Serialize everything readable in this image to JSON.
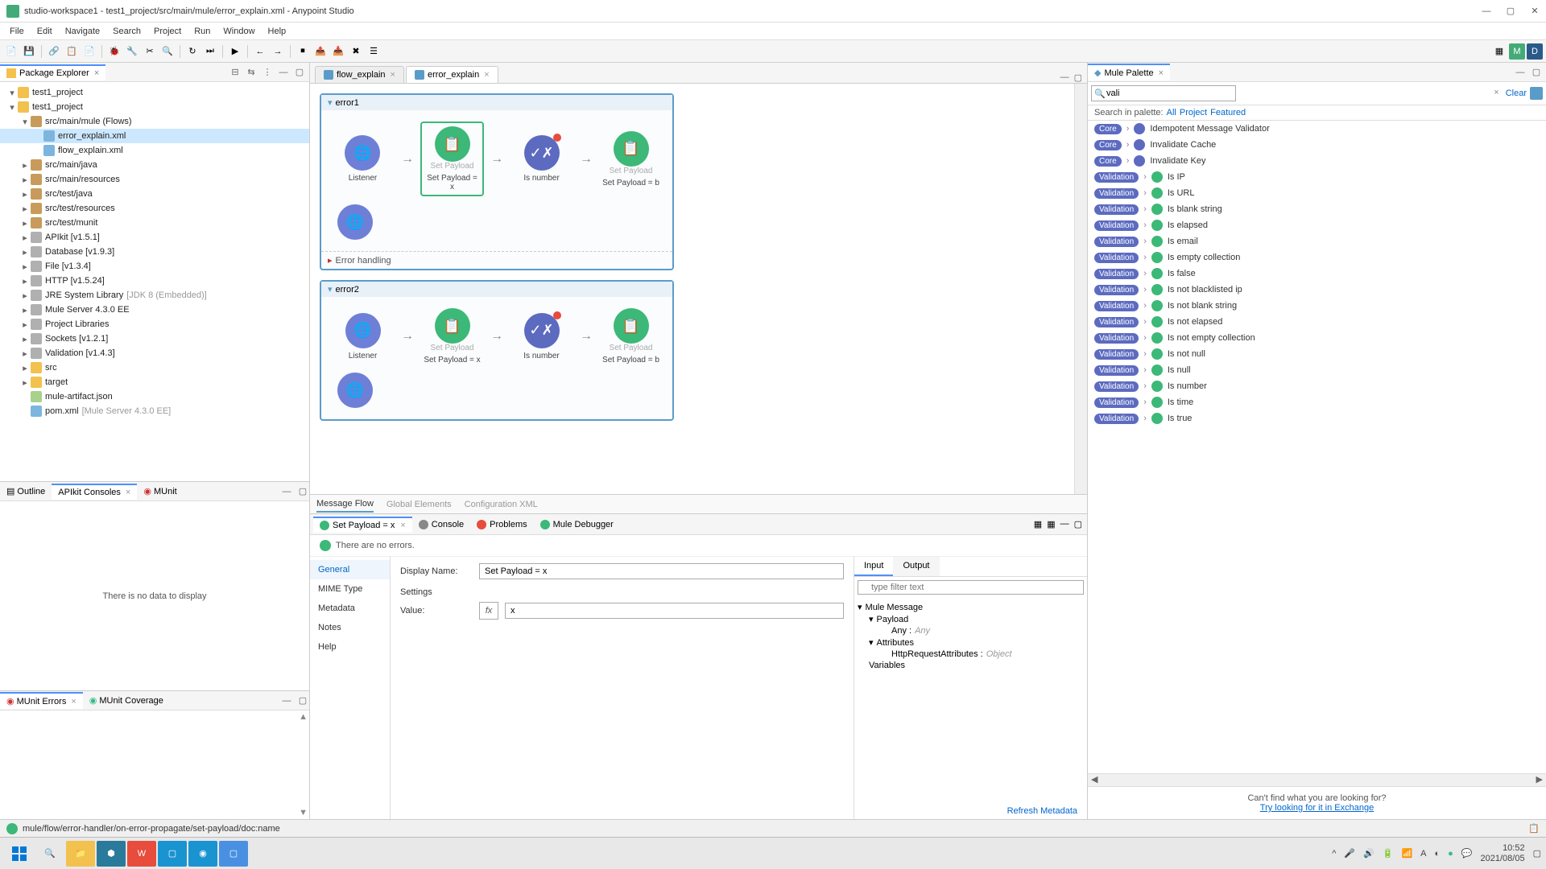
{
  "window": {
    "title": "studio-workspace1 - test1_project/src/main/mule/error_explain.xml - Anypoint Studio"
  },
  "menu": [
    "File",
    "Edit",
    "Navigate",
    "Search",
    "Project",
    "Run",
    "Window",
    "Help"
  ],
  "package_explorer": {
    "tab": "Package Explorer",
    "tree": [
      {
        "d": 0,
        "icon": "folder",
        "label": "test1_project",
        "exp": true
      },
      {
        "d": 0,
        "icon": "folder",
        "label": "test1_project",
        "exp": true
      },
      {
        "d": 1,
        "icon": "pkg",
        "label": "src/main/mule (Flows)",
        "exp": true
      },
      {
        "d": 2,
        "icon": "xml",
        "label": "error_explain.xml",
        "sel": true
      },
      {
        "d": 2,
        "icon": "xml",
        "label": "flow_explain.xml"
      },
      {
        "d": 1,
        "icon": "pkg",
        "label": "src/main/java",
        "exp": false
      },
      {
        "d": 1,
        "icon": "pkg",
        "label": "src/main/resources",
        "exp": false
      },
      {
        "d": 1,
        "icon": "pkg",
        "label": "src/test/java",
        "exp": false
      },
      {
        "d": 1,
        "icon": "pkg",
        "label": "src/test/resources",
        "exp": false
      },
      {
        "d": 1,
        "icon": "pkg",
        "label": "src/test/munit",
        "exp": false
      },
      {
        "d": 1,
        "icon": "jar",
        "label": "APIkit [v1.5.1]",
        "exp": false
      },
      {
        "d": 1,
        "icon": "jar",
        "label": "Database [v1.9.3]",
        "exp": false
      },
      {
        "d": 1,
        "icon": "jar",
        "label": "File [v1.3.4]",
        "exp": false
      },
      {
        "d": 1,
        "icon": "jar",
        "label": "HTTP [v1.5.24]",
        "exp": false
      },
      {
        "d": 1,
        "icon": "jar",
        "label": "JRE System Library",
        "hint": "[JDK 8 (Embedded)]",
        "exp": false
      },
      {
        "d": 1,
        "icon": "jar",
        "label": "Mule Server 4.3.0 EE",
        "exp": false
      },
      {
        "d": 1,
        "icon": "jar",
        "label": "Project Libraries",
        "exp": false
      },
      {
        "d": 1,
        "icon": "jar",
        "label": "Sockets [v1.2.1]",
        "exp": false
      },
      {
        "d": 1,
        "icon": "jar",
        "label": "Validation [v1.4.3]",
        "exp": false
      },
      {
        "d": 1,
        "icon": "folder",
        "label": "src",
        "exp": false
      },
      {
        "d": 1,
        "icon": "folder",
        "label": "target",
        "exp": false
      },
      {
        "d": 1,
        "icon": "json",
        "label": "mule-artifact.json"
      },
      {
        "d": 1,
        "icon": "xml",
        "label": "pom.xml",
        "hint": "[Mule Server 4.3.0 EE]"
      }
    ]
  },
  "editor": {
    "tabs": [
      {
        "label": "flow_explain",
        "active": false
      },
      {
        "label": "error_explain",
        "active": true
      }
    ],
    "flows": [
      {
        "name": "error1",
        "nodes": [
          {
            "type": "blue",
            "label": "Listener",
            "sub": "",
            "icon": "🌐"
          },
          {
            "type": "green",
            "label": "Set Payload = x",
            "sub": "Set Payload",
            "icon": "📋",
            "selected": true
          },
          {
            "type": "purple",
            "label": "Is number",
            "sub": "",
            "icon": "✓✗",
            "badge": true
          },
          {
            "type": "green",
            "label": "Set Payload = b",
            "sub": "Set Payload",
            "icon": "📋"
          }
        ],
        "error_handling": "Error handling"
      },
      {
        "name": "error2",
        "nodes": [
          {
            "type": "blue",
            "label": "Listener",
            "sub": "",
            "icon": "🌐"
          },
          {
            "type": "green",
            "label": "Set Payload = x",
            "sub": "Set Payload",
            "icon": "📋"
          },
          {
            "type": "purple",
            "label": "Is number",
            "sub": "",
            "icon": "✓✗",
            "badge": true
          },
          {
            "type": "green",
            "label": "Set Payload = b",
            "sub": "Set Payload",
            "icon": "📋"
          }
        ]
      }
    ],
    "canvas_tabs": [
      "Message Flow",
      "Global Elements",
      "Configuration XML"
    ]
  },
  "palette": {
    "tab": "Mule Palette",
    "search_value": "vali",
    "clear": "Clear",
    "filter_label": "Search in palette:",
    "filters": [
      "All",
      "Project",
      "Featured"
    ],
    "items": [
      {
        "cat": "Core",
        "name": "Idempotent Message Validator",
        "iconcls": "core"
      },
      {
        "cat": "Core",
        "name": "Invalidate Cache",
        "iconcls": "core"
      },
      {
        "cat": "Core",
        "name": "Invalidate Key",
        "iconcls": "core"
      },
      {
        "cat": "Validation",
        "name": "Is IP"
      },
      {
        "cat": "Validation",
        "name": "Is URL"
      },
      {
        "cat": "Validation",
        "name": "Is blank string"
      },
      {
        "cat": "Validation",
        "name": "Is elapsed"
      },
      {
        "cat": "Validation",
        "name": "Is email"
      },
      {
        "cat": "Validation",
        "name": "Is empty collection"
      },
      {
        "cat": "Validation",
        "name": "Is false"
      },
      {
        "cat": "Validation",
        "name": "Is not blacklisted ip"
      },
      {
        "cat": "Validation",
        "name": "Is not blank string"
      },
      {
        "cat": "Validation",
        "name": "Is not elapsed"
      },
      {
        "cat": "Validation",
        "name": "Is not empty collection"
      },
      {
        "cat": "Validation",
        "name": "Is not null"
      },
      {
        "cat": "Validation",
        "name": "Is null"
      },
      {
        "cat": "Validation",
        "name": "Is number"
      },
      {
        "cat": "Validation",
        "name": "Is time"
      },
      {
        "cat": "Validation",
        "name": "Is true"
      }
    ],
    "footer1": "Can't find what you are looking for?",
    "footer2": "Try looking for it in Exchange"
  },
  "outline": {
    "tabs": [
      "Outline",
      "APIkit Consoles",
      "MUnit"
    ],
    "empty": "There is no data to display"
  },
  "munit_lower": {
    "tabs": [
      "MUnit Errors",
      "MUnit Coverage"
    ]
  },
  "properties": {
    "tabs": [
      {
        "label": "Set Payload = x",
        "active": true,
        "icon": "green"
      },
      {
        "label": "Console",
        "icon": "console"
      },
      {
        "label": "Problems",
        "icon": "problems"
      },
      {
        "label": "Mule Debugger",
        "icon": "debug"
      }
    ],
    "status": "There are no errors.",
    "nav": [
      "General",
      "MIME Type",
      "Metadata",
      "Notes",
      "Help"
    ],
    "display_name_label": "Display Name:",
    "display_name_value": "Set Payload = x",
    "settings_label": "Settings",
    "value_label": "Value:",
    "value_value": "x",
    "io_tabs": [
      "Input",
      "Output"
    ],
    "io_filter_placeholder": "type filter text",
    "io_tree": [
      {
        "label": "Mule Message",
        "d": 0,
        "exp": true
      },
      {
        "label": "Payload",
        "d": 1,
        "exp": true
      },
      {
        "label": "Any :",
        "type": "Any",
        "d": 2
      },
      {
        "label": "Attributes",
        "d": 1,
        "exp": true
      },
      {
        "label": "HttpRequestAttributes :",
        "type": "Object",
        "d": 2
      },
      {
        "label": "Variables",
        "d": 0
      }
    ],
    "refresh": "Refresh Metadata"
  },
  "statusbar": {
    "path": "mule/flow/error-handler/on-error-propagate/set-payload/doc:name"
  },
  "taskbar": {
    "time": "10:52",
    "date": "2021/08/05"
  }
}
